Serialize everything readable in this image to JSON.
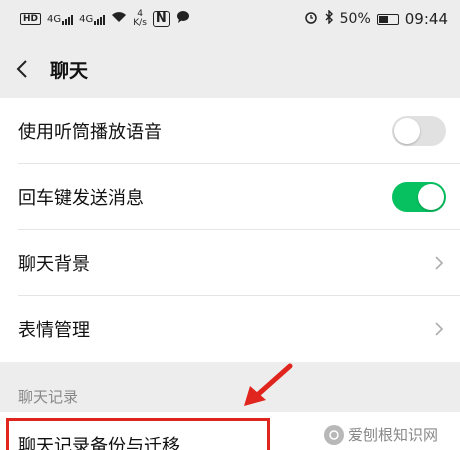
{
  "status_bar": {
    "hd": "HD",
    "signal1": "4G",
    "signal2": "4G",
    "net_speed_value": "4",
    "net_speed_unit": "K/s",
    "nfc": "N",
    "battery": "50%",
    "time": "09:44"
  },
  "nav": {
    "title": "聊天"
  },
  "settings": {
    "items": [
      {
        "label": "使用听筒播放语音",
        "toggle": "off"
      },
      {
        "label": "回车键发送消息",
        "toggle": "on"
      },
      {
        "label": "聊天背景"
      },
      {
        "label": "表情管理"
      }
    ]
  },
  "section": {
    "header": "聊天记录"
  },
  "backup": {
    "label": "聊天记录备份与迁移"
  },
  "watermark": {
    "text": "爱刨根知识网"
  },
  "colors": {
    "accent_green": "#07c160",
    "highlight_red": "#e0241e",
    "background": "#ededed"
  },
  "battery_level": 0.5
}
